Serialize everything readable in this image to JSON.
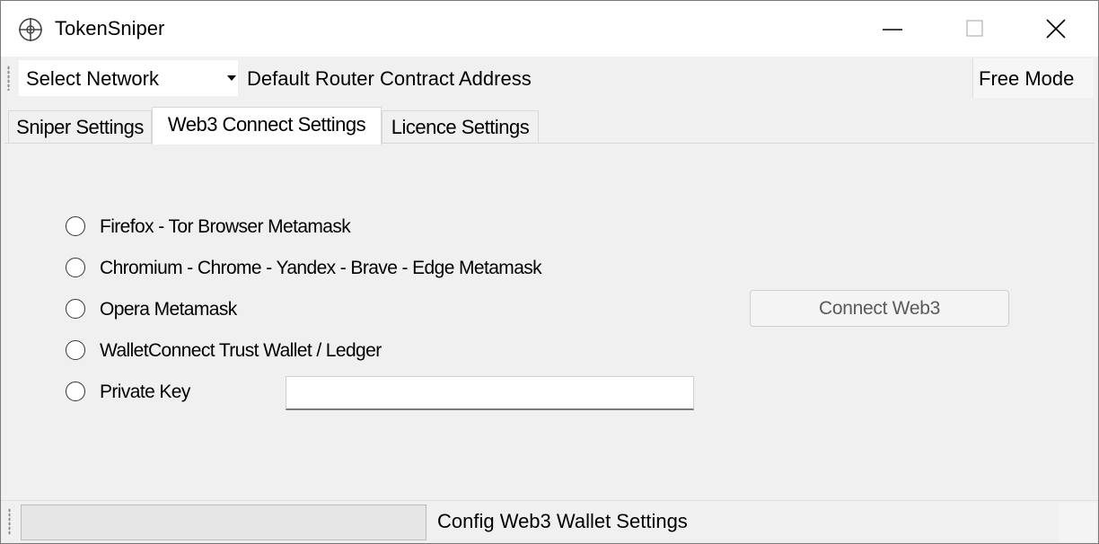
{
  "window": {
    "title": "TokenSniper",
    "icons": [
      "app-crosshair-icon",
      "minimize-icon",
      "maximize-icon",
      "close-icon"
    ]
  },
  "toolbar": {
    "network_select": "Select Network",
    "router_label": "Default Router Contract Address",
    "mode_label": "Free Mode"
  },
  "tabs": [
    "Sniper Settings",
    "Web3 Connect Settings",
    "Licence Settings"
  ],
  "active_tab": "Web3 Connect Settings",
  "web3": {
    "options": [
      "Firefox - Tor Browser Metamask",
      "Chromium - Chrome - Yandex - Brave - Edge Metamask",
      "Opera Metamask",
      "WalletConnect Trust Wallet / Ledger",
      "Private Key"
    ],
    "private_key_value": "",
    "connect_button": "Connect Web3"
  },
  "statusbar": {
    "text": "Config Web3 Wallet Settings"
  }
}
